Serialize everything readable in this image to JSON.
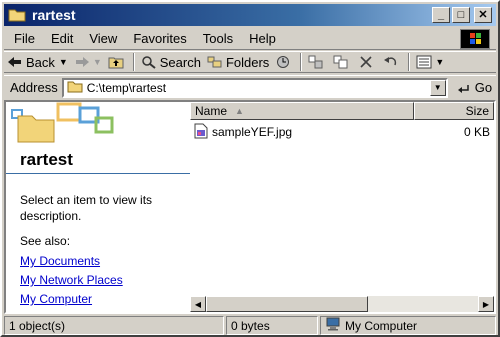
{
  "window": {
    "title": "rartest"
  },
  "title_buttons": {
    "minimize": "_",
    "maximize": "□",
    "close": "✕"
  },
  "menubar": {
    "items": [
      "File",
      "Edit",
      "View",
      "Favorites",
      "Tools",
      "Help"
    ]
  },
  "toolbar": {
    "back_label": "Back",
    "search_label": "Search",
    "folders_label": "Folders"
  },
  "address": {
    "label": "Address",
    "value": "C:\\temp\\rartest",
    "go_label": "Go"
  },
  "leftpane": {
    "folder_title": "rartest",
    "description": "Select an item to view its description.",
    "see_also_label": "See also:",
    "links": [
      "My Documents",
      "My Network Places",
      "My Computer"
    ]
  },
  "filelist": {
    "columns": {
      "name": "Name",
      "size": "Size"
    },
    "rows": [
      {
        "name": "sampleYEF.jpg",
        "size": "0 KB"
      }
    ]
  },
  "statusbar": {
    "objects": "1 object(s)",
    "bytes": "0 bytes",
    "location": "My Computer"
  },
  "colors": {
    "titlebar_start": "#0a246a",
    "titlebar_end": "#a6caf0",
    "face": "#d4d0c8",
    "link": "#0000cc"
  }
}
